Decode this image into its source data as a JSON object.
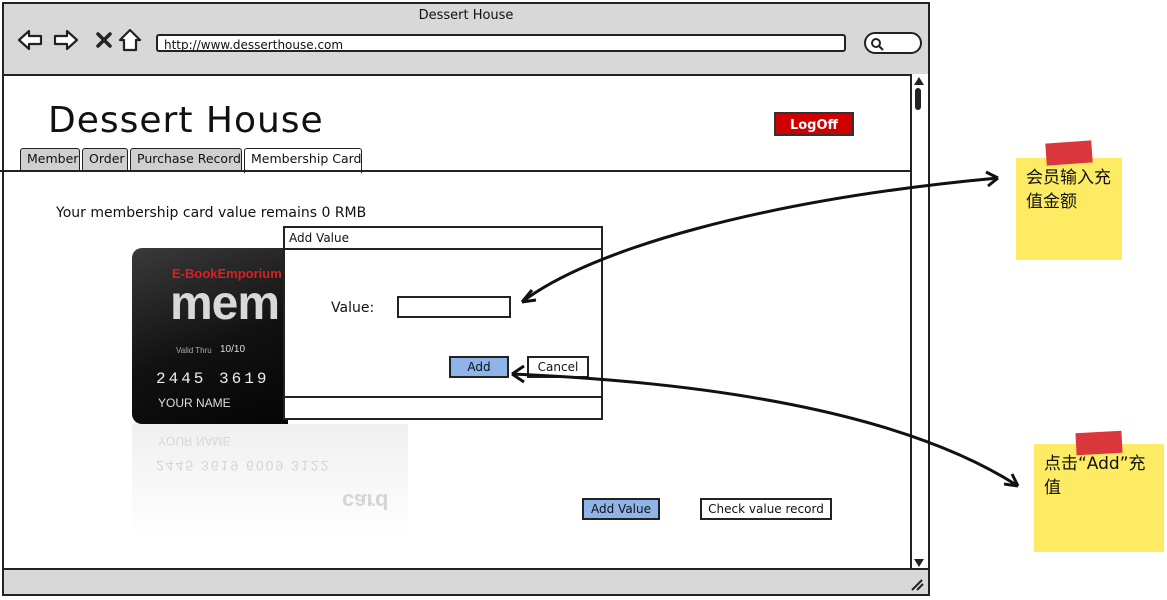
{
  "window": {
    "title": "Dessert House",
    "url": "http://www.desserthouse.com"
  },
  "header": {
    "site_title": "Dessert House",
    "logoff_label": "LogOff"
  },
  "tabs": [
    {
      "label": "Member"
    },
    {
      "label": "Order"
    },
    {
      "label": "Purchase Record"
    },
    {
      "label": "Membership Card"
    }
  ],
  "main": {
    "remains_text": "Your membership card value remains 0 RMB",
    "add_value_label": "Add Value",
    "check_record_label": "Check value record"
  },
  "card": {
    "brand": "E-BookEmporium",
    "word": "mem",
    "valid_label": "Valid Thru",
    "valid_date": "10/10",
    "number": "2445 3619",
    "name": "YOUR NAME",
    "reflect_name": "YOUR NAME",
    "reflect_number": "2445 3619 6009 3122",
    "reflect_word": "card"
  },
  "dialog": {
    "title": "Add Value",
    "value_label": "Value:",
    "input_value": "",
    "add_label": "Add",
    "cancel_label": "Cancel"
  },
  "notes": [
    {
      "text": "会员输入充值金额"
    },
    {
      "text": "点击“Add”充值"
    }
  ],
  "colors": {
    "logoff": "#d00000",
    "button_blue": "#8fb4ea",
    "sticky": "#fdeb63",
    "pin": "#d9373b"
  }
}
